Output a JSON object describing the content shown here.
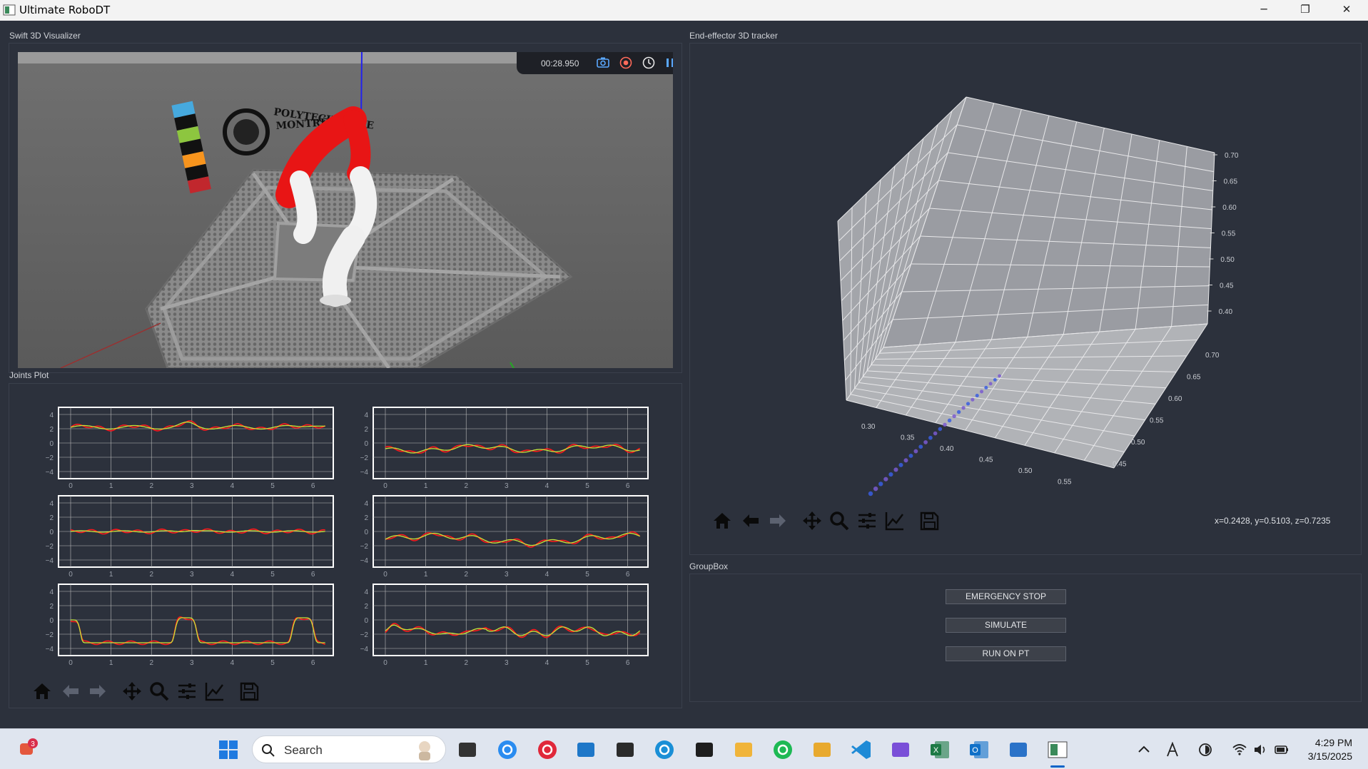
{
  "window": {
    "title": "Ultimate RoboDT",
    "minimize": "─",
    "maximize": "❐",
    "close": "✕"
  },
  "visualizer": {
    "label": "Swift 3D Visualizer",
    "timecode": "00:28.950",
    "logo_text": [
      "POLYTECHNIQUE",
      "MONTRÉAL"
    ],
    "overlay_icons": [
      "camera-icon",
      "record-icon",
      "clock-icon",
      "pause-icon"
    ]
  },
  "tracker": {
    "label": "End-effector 3D tracker",
    "z_ticks": [
      "0.70",
      "0.65",
      "0.60",
      "0.55",
      "0.50",
      "0.45",
      "0.40"
    ],
    "y_ticks": [
      "0.70",
      "0.65",
      "0.60",
      "0.55",
      "0.50",
      "0.45"
    ],
    "x_ticks": [
      "0.30",
      "0.35",
      "0.40",
      "0.45",
      "0.50",
      "0.55"
    ],
    "coordinates": "x=0.2428, y=0.5103, z=0.7235"
  },
  "toolbar_icons": [
    "home-icon",
    "back-icon",
    "forward-icon",
    "pan-icon",
    "zoom-icon",
    "configure-subplots-icon",
    "edit-axis-icon",
    "save-icon"
  ],
  "joints_plot": {
    "label": "Joints Plot",
    "x_ticks": [
      "0",
      "1",
      "2",
      "3",
      "4",
      "5",
      "6"
    ],
    "y_ticks": [
      "4",
      "2",
      "0",
      "−2",
      "−4"
    ],
    "colors": {
      "actual": "#ff1a1a",
      "target": "#c8e63a",
      "grid": "#bbbbbb",
      "axes_bg": "#2c313c"
    }
  },
  "groupbox": {
    "label": "GroupBox",
    "emergency_stop": "EMERGENCY STOP",
    "simulate": "SIMULATE",
    "run_on_pt": "RUN ON PT"
  },
  "taskbar": {
    "search_placeholder": "Search",
    "badge_count": "3",
    "time": "4:29 PM",
    "date": "3/15/2025",
    "apps": [
      "widgets-icon",
      "start-icon",
      "taskview-icon",
      "copilot-icon",
      "opera-icon",
      "photos-icon",
      "terminal-icon",
      "edge-icon",
      "cmd-icon",
      "explorer-icon",
      "spotify-icon",
      "folder-icon",
      "vscode-icon",
      "obsidian-icon",
      "excel-icon",
      "outlook-icon",
      "notepad-icon",
      "robodt-icon"
    ],
    "tray": [
      "chevron-up-icon",
      "font-icon",
      "focus-icon",
      "wifi-icon",
      "volume-icon",
      "battery-icon"
    ]
  }
}
